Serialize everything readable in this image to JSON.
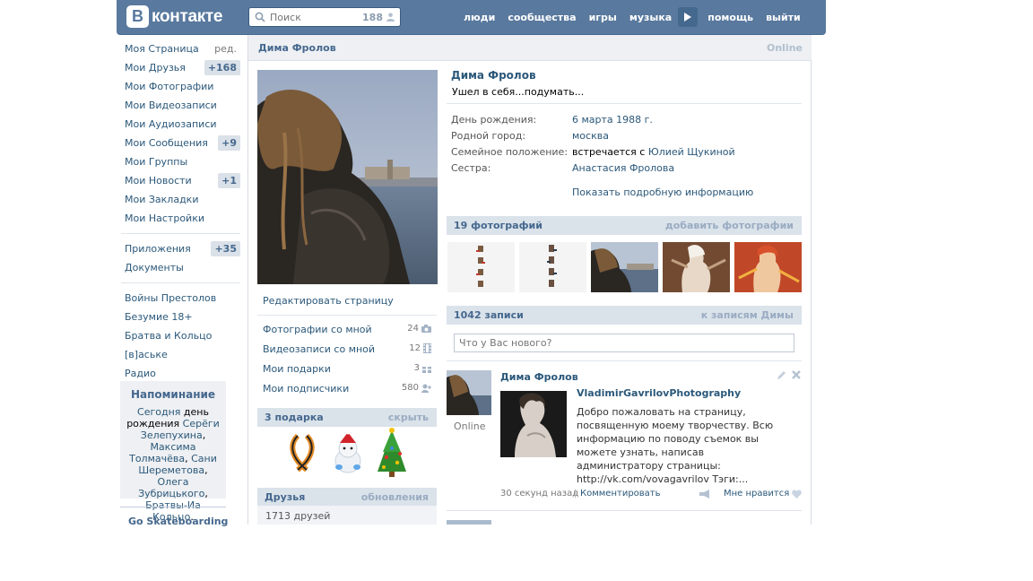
{
  "header": {
    "logo_letter": "В",
    "logo_text": "контакте",
    "search_placeholder": "Поиск",
    "search_count": "188",
    "nav": [
      "люди",
      "сообщества",
      "игры",
      "музыка",
      "помощь",
      "выйти"
    ]
  },
  "sidebar": {
    "edit_label": "ред.",
    "items": [
      {
        "label": "Моя Страница",
        "badge": ""
      },
      {
        "label": "Мои Друзья",
        "badge": "+168"
      },
      {
        "label": "Мои Фотографии",
        "badge": ""
      },
      {
        "label": "Мои Видеозаписи",
        "badge": ""
      },
      {
        "label": "Мои Аудиозаписи",
        "badge": ""
      },
      {
        "label": "Мои Сообщения",
        "badge": "+9"
      },
      {
        "label": "Мои Группы",
        "badge": ""
      },
      {
        "label": "Мои Новости",
        "badge": "+1"
      },
      {
        "label": "Мои Закладки",
        "badge": ""
      },
      {
        "label": "Мои Настройки",
        "badge": ""
      }
    ],
    "apps": [
      {
        "label": "Приложения",
        "badge": "+35"
      },
      {
        "label": "Документы",
        "badge": ""
      }
    ],
    "groups": [
      "Войны Престолов",
      "Безумие 18+",
      "Братва и Кольцо",
      "[в]аське",
      "Радио"
    ],
    "reminder": {
      "title": "Напоминание",
      "t1": "Сегодня",
      "t2": "день рождения",
      "t3": "Серёги Зелепухина",
      "t4": "Максима Толмачёва",
      "t5": "Сани Шереметова",
      "t6": "Олега Зубрицького",
      "t7": "Братвы-Иа Кольцо"
    },
    "promo_title": "Go Skateboarding"
  },
  "profile": {
    "header_name": "Дима Фролов",
    "header_status": "Online",
    "name": "Дима Фролов",
    "status": "Ушел в себя...подумать...",
    "info": [
      {
        "label": "День рождения:",
        "value": "6 марта 1988 г.",
        "value_color": "#2b587a"
      },
      {
        "label": "Родной город:",
        "value": "москва",
        "value_color": "#2b587a"
      },
      {
        "label": "Семейное положение:",
        "value_prefix": "встречается с ",
        "value": "Юлией Щукиной",
        "value_color": "#2b587a"
      },
      {
        "label": "Сестра:",
        "value": "Анастасия Фролова",
        "value_color": "#2b587a"
      }
    ],
    "show_more": "Показать подробную информацию",
    "edit_page": "Редактировать страницу",
    "links": [
      {
        "label": "Фотографии со мной",
        "count": "24",
        "icon": "camera-icon"
      },
      {
        "label": "Видеозаписи со мной",
        "count": "12",
        "icon": "film-icon"
      },
      {
        "label": "Мои подарки",
        "count": "3",
        "icon": "gift-icon"
      },
      {
        "label": "Мои подписчики",
        "count": "580",
        "icon": "followers-icon"
      }
    ],
    "gifts": {
      "title": "3 подарка",
      "action": "скрыть"
    },
    "friends": {
      "title": "Друзья",
      "action": "обновления",
      "count": "1713 друзей"
    },
    "photos": {
      "title": "19 фотографий",
      "action": "добавить фотографии"
    },
    "wall": {
      "title": "1042 записи",
      "action": "к записям Димы",
      "placeholder": "Что у Вас нового?"
    }
  },
  "post": {
    "author": "Дима Фролов",
    "online": "Online",
    "title": "VladimirGavrilovPhotography",
    "text": "Добро пожаловать на страницу, посвященную моему творчеству. Всю информацию по поводу съемок вы можете узнать, написав администратору страницы: http://vk.com/vovagavrilov Тэги:...",
    "time": "30 секунд назад",
    "separator": "|",
    "comment": "Комментировать",
    "like": "Мне нравится"
  }
}
